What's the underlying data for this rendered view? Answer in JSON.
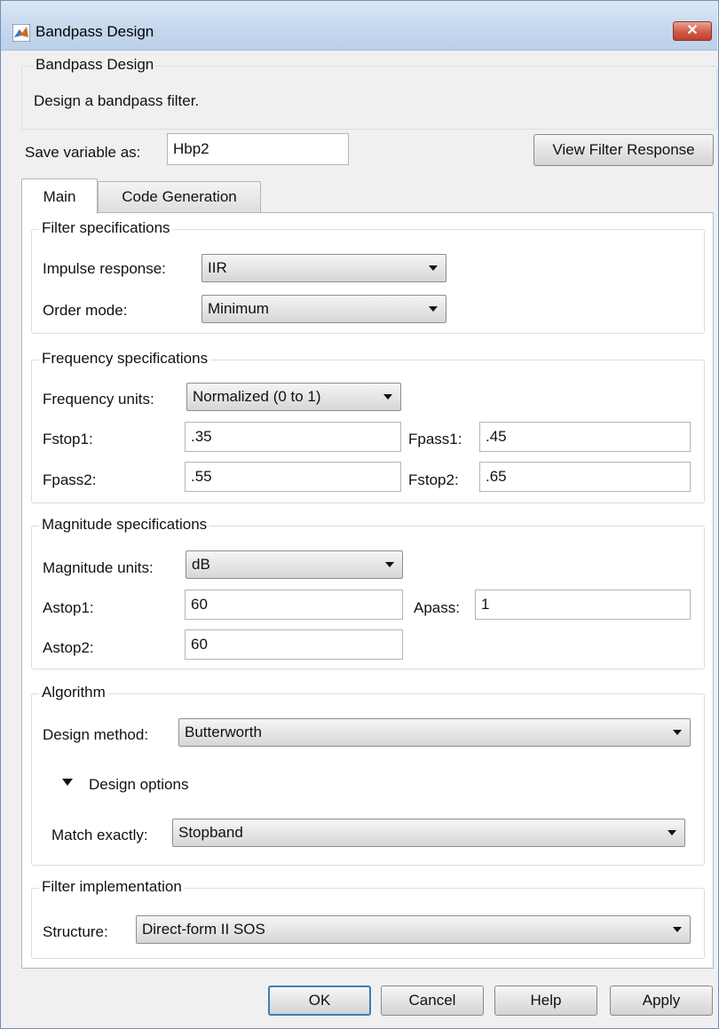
{
  "window": {
    "title": "Bandpass Design",
    "close_symbol": "✕",
    "icon": "matlab-logo-icon"
  },
  "description": {
    "title": "Bandpass Design",
    "text": "Design a bandpass filter."
  },
  "variable": {
    "label": "Save variable as:",
    "value": "Hbp2",
    "view_button": "View Filter Response"
  },
  "tabs": [
    {
      "label": "Main",
      "selected": true
    },
    {
      "label": "Code Generation",
      "selected": false
    }
  ],
  "filter_specs": {
    "title": "Filter specifications",
    "impulse_label": "Impulse response:",
    "impulse_value": "IIR",
    "order_label": "Order mode:",
    "order_value": "Minimum"
  },
  "frequency_specs": {
    "title": "Frequency specifications",
    "units_label": "Frequency units:",
    "units_value": "Normalized (0 to 1)",
    "fstop1_label": "Fstop1:",
    "fstop1_value": ".35",
    "fpass1_label": "Fpass1:",
    "fpass1_value": ".45",
    "fpass2_label": "Fpass2:",
    "fpass2_value": ".55",
    "fstop2_label": "Fstop2:",
    "fstop2_value": ".65"
  },
  "magnitude_specs": {
    "title": "Magnitude specifications",
    "units_label": "Magnitude units:",
    "units_value": "dB",
    "astop1_label": "Astop1:",
    "astop1_value": "60",
    "apass_label": "Apass:",
    "apass_value": "1",
    "astop2_label": "Astop2:",
    "astop2_value": "60"
  },
  "algorithm": {
    "title": "Algorithm",
    "method_label": "Design method:",
    "method_value": "Butterworth",
    "options_label": "Design options",
    "match_label": "Match exactly:",
    "match_value": "Stopband"
  },
  "implementation": {
    "title": "Filter implementation",
    "structure_label": "Structure:",
    "structure_value": "Direct-form II SOS"
  },
  "buttons": {
    "ok": "OK",
    "cancel": "Cancel",
    "help": "Help",
    "apply": "Apply"
  },
  "colors": {
    "title_bar": "#c5d7ee",
    "close_button": "#d25b46",
    "default_button_border": "#3c7fb1"
  }
}
